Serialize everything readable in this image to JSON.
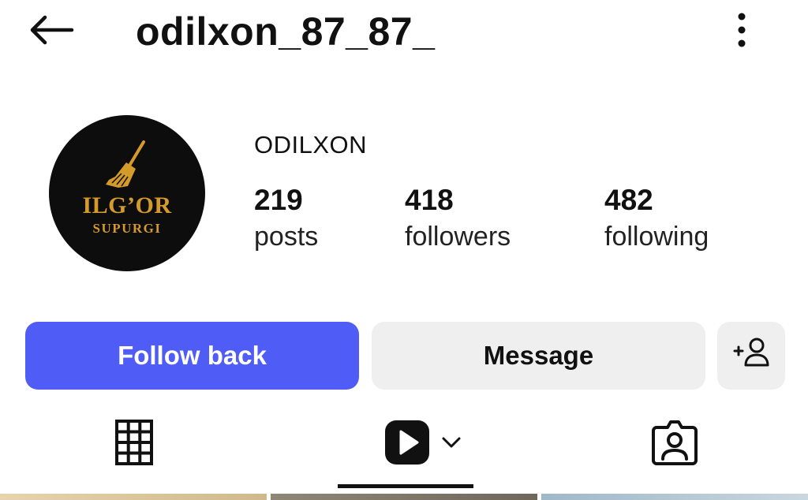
{
  "header": {
    "username": "odilxon_87_87_",
    "back_icon": "arrow-left-icon",
    "more_icon": "more-vertical-icon"
  },
  "profile": {
    "avatar": {
      "logo_line1": "ILG’OR",
      "logo_line2": "SUPURGI",
      "background": "#0d0d0d",
      "accent": "#d49a2a",
      "icon": "broom-icon"
    },
    "display_name": "ODILXON",
    "stats": [
      {
        "value": "219",
        "label": "posts"
      },
      {
        "value": "418",
        "label": "followers"
      },
      {
        "value": "482",
        "label": "following"
      }
    ]
  },
  "actions": {
    "follow_back_label": "Follow back",
    "message_label": "Message",
    "add_user_label": "+",
    "add_user_icon": "add-person-icon",
    "follow_color": "#4f5cf5",
    "secondary_color": "#efefef"
  },
  "tabs": [
    {
      "name": "posts",
      "icon": "grid-icon",
      "active": false
    },
    {
      "name": "reels",
      "icon": "reels-icon",
      "active": true
    },
    {
      "name": "tagged",
      "icon": "tagged-person-icon",
      "active": false
    }
  ]
}
